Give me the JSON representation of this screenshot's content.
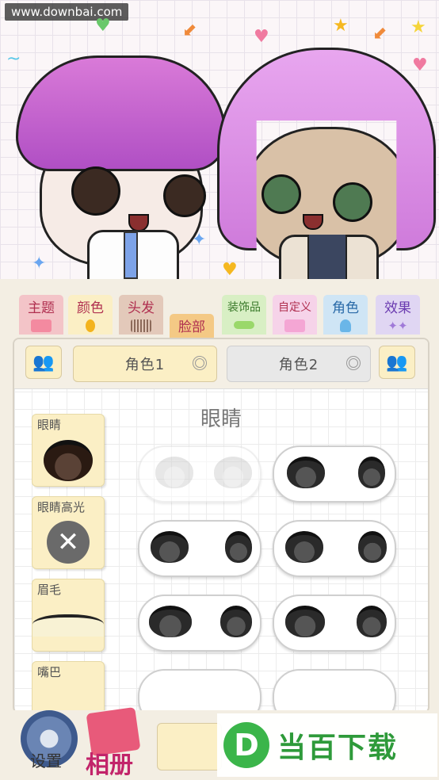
{
  "watermark": "www.downbai.com",
  "tabs": [
    {
      "label": "主题",
      "bg": "#f3c4c8",
      "icon": "clapper-icon"
    },
    {
      "label": "颜色",
      "bg": "#fbefc5",
      "icon": "paint-drop-icon"
    },
    {
      "label": "头发",
      "bg": "#e3c9ba",
      "icon": "comb-icon"
    },
    {
      "label": "脸部",
      "bg": "#f4c985",
      "icon": "",
      "active": true
    },
    {
      "label": "装饰品",
      "bg": "#d8efc4",
      "icon": "glasses-icon"
    },
    {
      "label": "自定义",
      "bg": "#f6d3e9",
      "icon": "image-icon"
    },
    {
      "label": "角色",
      "bg": "#cfe5f5",
      "icon": "person-icon"
    },
    {
      "label": "效果",
      "bg": "#e0d6f3",
      "icon": "sparkle-icon"
    }
  ],
  "character_select": {
    "char1_label": "角色1",
    "char2_label": "角色2",
    "char1_selected": true
  },
  "section_title": "眼睛",
  "categories": [
    {
      "label": "眼睛"
    },
    {
      "label": "眼睛高光"
    },
    {
      "label": "眉毛"
    },
    {
      "label": "嘴巴"
    }
  ],
  "bottom": {
    "settings_label": "设置",
    "album_label": "相册",
    "logo_text": "当百下载",
    "logo_letter": "D"
  }
}
